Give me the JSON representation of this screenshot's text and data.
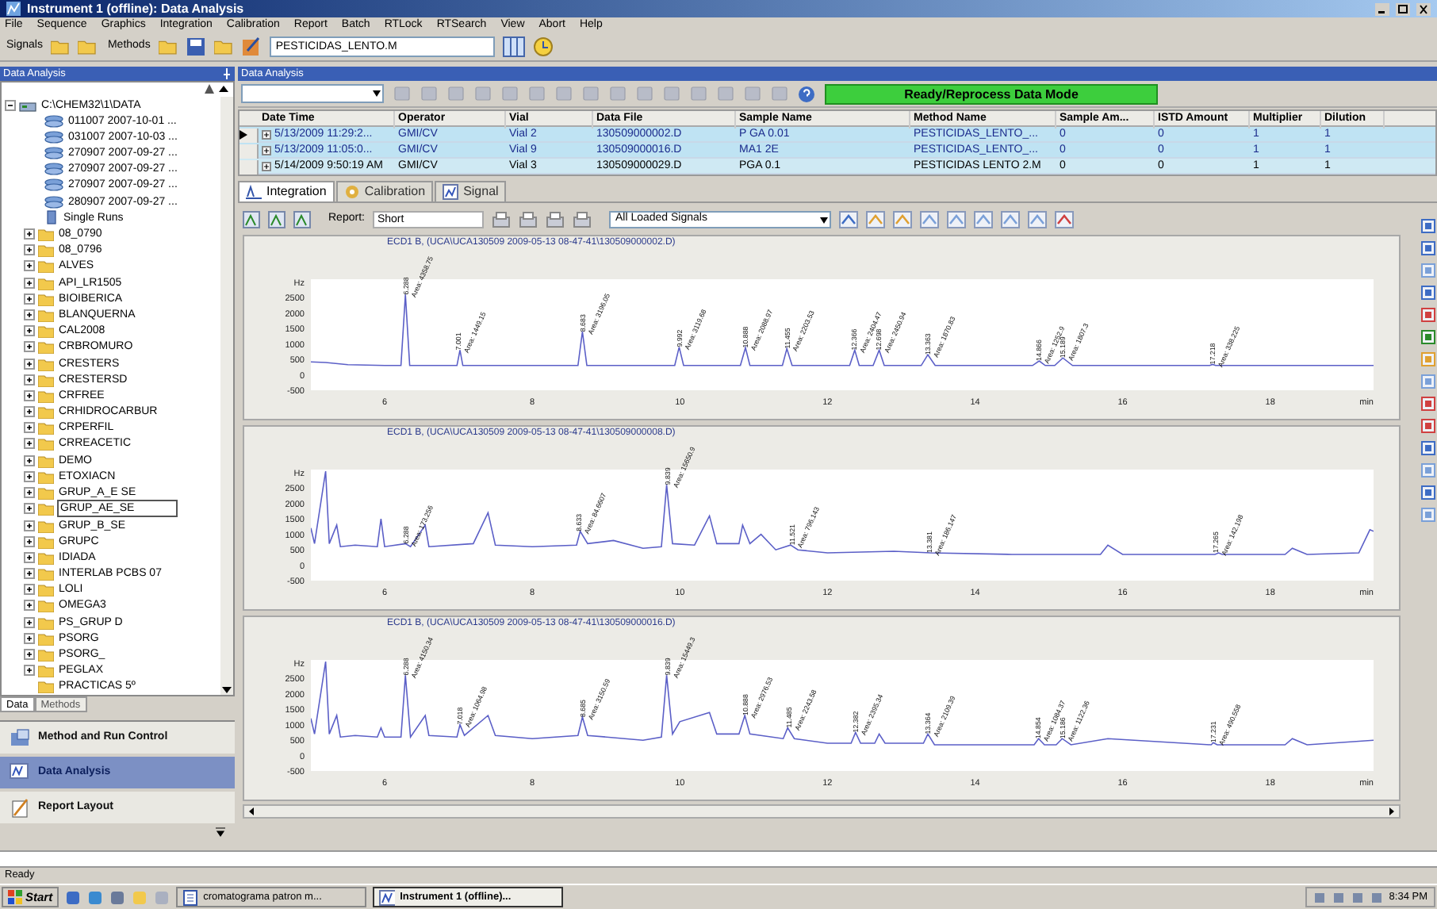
{
  "window": {
    "title": "Instrument 1 (offline): Data Analysis"
  },
  "menu": [
    "File",
    "Sequence",
    "Graphics",
    "Integration",
    "Calibration",
    "Report",
    "Batch",
    "RTLock",
    "RTSearch",
    "View",
    "Abort",
    "Help"
  ],
  "toolbar": {
    "signals_label": "Signals",
    "methods_label": "Methods",
    "method_field": "PESTICIDAS_LENTO.M"
  },
  "left_panel": {
    "title": "Data Analysis",
    "tree": [
      {
        "label": "C:\\CHEM32\\1\\DATA",
        "kind": "root",
        "expanded": true,
        "selected": false,
        "children": [
          {
            "label": "011007 2007-10-01 ...",
            "kind": "sequence",
            "selected": false
          },
          {
            "label": "031007 2007-10-03 ...",
            "kind": "sequence",
            "selected": false
          },
          {
            "label": "270907 2007-09-27 ...",
            "kind": "sequence",
            "selected": false
          },
          {
            "label": "270907 2007-09-27 ...",
            "kind": "sequence",
            "selected": false
          },
          {
            "label": "270907 2007-09-27 ...",
            "kind": "sequence",
            "selected": false
          },
          {
            "label": "280907 2007-09-27 ...",
            "kind": "sequence",
            "selected": false
          },
          {
            "label": "Single Runs",
            "kind": "single",
            "selected": false
          },
          {
            "label": "08_0790",
            "kind": "folder",
            "expanded": false,
            "selected": false
          },
          {
            "label": "08_0796",
            "kind": "folder",
            "expanded": false,
            "selected": false
          },
          {
            "label": "ALVES",
            "kind": "folder",
            "expanded": false,
            "selected": false
          },
          {
            "label": "API_LR1505",
            "kind": "folder",
            "expanded": false,
            "selected": false
          },
          {
            "label": "BIOIBERICA",
            "kind": "folder",
            "expanded": false,
            "selected": false
          },
          {
            "label": "BLANQUERNA",
            "kind": "folder",
            "expanded": false,
            "selected": false
          },
          {
            "label": "CAL2008",
            "kind": "folder",
            "expanded": false,
            "selected": false
          },
          {
            "label": "CRBROMURO",
            "kind": "folder",
            "expanded": false,
            "selected": false
          },
          {
            "label": "CRESTERS",
            "kind": "folder",
            "expanded": false,
            "selected": false
          },
          {
            "label": "CRESTERSD",
            "kind": "folder",
            "expanded": false,
            "selected": false
          },
          {
            "label": "CRFREE",
            "kind": "folder",
            "expanded": false,
            "selected": false
          },
          {
            "label": "CRHIDROCARBUR",
            "kind": "folder",
            "expanded": false,
            "selected": false
          },
          {
            "label": "CRPERFIL",
            "kind": "folder",
            "expanded": false,
            "selected": false
          },
          {
            "label": "CRREACETIC",
            "kind": "folder",
            "expanded": false,
            "selected": false
          },
          {
            "label": "DEMO",
            "kind": "folder",
            "expanded": false,
            "selected": false
          },
          {
            "label": "ETOXIACN",
            "kind": "folder",
            "expanded": false,
            "selected": false
          },
          {
            "label": "GRUP_A_E SE",
            "kind": "folder",
            "expanded": false,
            "selected": false
          },
          {
            "label": "GRUP_AE_SE",
            "kind": "folder",
            "expanded": false,
            "selected": true
          },
          {
            "label": "GRUP_B_SE",
            "kind": "folder",
            "expanded": false,
            "selected": false
          },
          {
            "label": "GRUPC",
            "kind": "folder",
            "expanded": false,
            "selected": false
          },
          {
            "label": "IDIADA",
            "kind": "folder",
            "expanded": false,
            "selected": false
          },
          {
            "label": "INTERLAB PCBS 07",
            "kind": "folder",
            "expanded": false,
            "selected": false
          },
          {
            "label": "LOLI",
            "kind": "folder",
            "expanded": false,
            "selected": false
          },
          {
            "label": "OMEGA3",
            "kind": "folder",
            "expanded": false,
            "selected": false
          },
          {
            "label": "PS_GRUP D",
            "kind": "folder",
            "expanded": false,
            "selected": false
          },
          {
            "label": "PSORG",
            "kind": "folder",
            "expanded": false,
            "selected": false
          },
          {
            "label": "PSORG_",
            "kind": "folder",
            "expanded": false,
            "selected": false
          },
          {
            "label": "PEGLAX",
            "kind": "folder",
            "expanded": false,
            "selected": false
          },
          {
            "label": "PRACTICAS 5º",
            "kind": "folder",
            "selected": false
          }
        ]
      }
    ],
    "tabs": [
      {
        "label": "Data",
        "selected": true
      },
      {
        "label": "Methods",
        "selected": false
      }
    ],
    "nav": [
      {
        "label": "Method and Run Control",
        "selected": false
      },
      {
        "label": "Data Analysis",
        "selected": true
      },
      {
        "label": "Report Layout",
        "selected": false
      }
    ]
  },
  "main": {
    "title": "Data Analysis",
    "mode_status": "Ready/Reprocess Data Mode",
    "table": {
      "columns": [
        "Date Time",
        "Operator",
        "Vial",
        "Data File",
        "Sample Name",
        "Method Name",
        "Sample Am...",
        "ISTD Amount",
        "Multiplier",
        "Dilution"
      ],
      "rows": [
        {
          "current": true,
          "selected": true,
          "cells": [
            "5/13/2009 11:29:2...",
            "GMI/CV",
            "Vial 2",
            "130509000002.D",
            "P GA 0.01",
            "PESTICIDAS_LENTO_...",
            "0",
            "0",
            "1",
            "1"
          ]
        },
        {
          "current": false,
          "selected": true,
          "cells": [
            "5/13/2009 11:05:0...",
            "GMI/CV",
            "Vial 9",
            "130509000016.D",
            "MA1 2E",
            "PESTICIDAS_LENTO_...",
            "0",
            "0",
            "1",
            "1"
          ]
        },
        {
          "current": false,
          "selected": false,
          "cells": [
            "5/14/2009 9:50:19 AM",
            "GMI/CV",
            "Vial 3",
            "130509000029.D",
            "PGA 0.1",
            "PESTICIDAS LENTO 2.M",
            "0",
            "0",
            "1",
            "1"
          ]
        }
      ]
    },
    "view_tabs": [
      {
        "label": "Integration",
        "selected": true
      },
      {
        "label": "Calibration",
        "selected": false
      },
      {
        "label": "Signal",
        "selected": false
      }
    ],
    "report_label": "Report:",
    "report_field": "Short",
    "signal_select": "All Loaded Signals",
    "charts": [
      {
        "chart_data": {
          "type": "line",
          "title": "ECD1 B, (UCA\\UCA130509 2009-05-13 08-47-41\\130509000002.D)",
          "xlabel": "min",
          "ylabel": "Hz",
          "xlim": [
            5,
            19.4
          ],
          "ylim": [
            -500,
            3100
          ],
          "xticks": [
            6,
            8,
            10,
            12,
            14,
            16,
            18
          ],
          "yticks": [
            -500,
            0,
            500,
            1000,
            1500,
            2000,
            2500
          ],
          "x": [
            5,
            5.2,
            5.5,
            6,
            6.22,
            6.28,
            6.34,
            6.98,
            7.02,
            7.06,
            8.62,
            8.68,
            8.74,
            9.93,
            9.99,
            10.05,
            10.82,
            10.89,
            10.95,
            11.39,
            11.45,
            11.52,
            12.3,
            12.37,
            12.43,
            12.62,
            12.7,
            12.77,
            13.27,
            13.36,
            13.46,
            14.78,
            14.87,
            14.95,
            15.08,
            15.19,
            15.32,
            17.18,
            17.22,
            17.26,
            19.4
          ],
          "series": [
            {
              "color": "#5b5fc7",
              "values": [
                420,
                400,
                330,
                300,
                300,
                2600,
                300,
                300,
                800,
                300,
                300,
                1400,
                300,
                300,
                900,
                300,
                300,
                880,
                300,
                300,
                850,
                300,
                300,
                800,
                300,
                300,
                800,
                300,
                300,
                650,
                300,
                300,
                450,
                300,
                300,
                550,
                300,
                300,
                340,
                300,
                300
              ]
            }
          ],
          "annotations": [
            {
              "x": 6.288,
              "y": 2600,
              "text": "6.288"
            },
            {
              "x": 6.288,
              "y": 2600,
              "text": "Area: 4358.75"
            },
            {
              "x": 7.001,
              "y": 800,
              "text": "7.001"
            },
            {
              "x": 7.001,
              "y": 800,
              "text": "Area: 1449.15"
            },
            {
              "x": 8.683,
              "y": 1400,
              "text": "8.683"
            },
            {
              "x": 8.683,
              "y": 1400,
              "text": "Area: 3196.05"
            },
            {
              "x": 9.992,
              "y": 900,
              "text": "9.992"
            },
            {
              "x": 9.992,
              "y": 900,
              "text": "Area: 3119.68"
            },
            {
              "x": 10.888,
              "y": 880,
              "text": "10.888"
            },
            {
              "x": 10.888,
              "y": 880,
              "text": "Area: 2088.97"
            },
            {
              "x": 11.455,
              "y": 850,
              "text": "11.455"
            },
            {
              "x": 11.455,
              "y": 850,
              "text": "Area: 2203.53"
            },
            {
              "x": 12.366,
              "y": 800,
              "text": "12.366"
            },
            {
              "x": 12.366,
              "y": 800,
              "text": "Area: 2404.47"
            },
            {
              "x": 12.698,
              "y": 800,
              "text": "12.698"
            },
            {
              "x": 12.698,
              "y": 800,
              "text": "Area: 2450.94"
            },
            {
              "x": 13.363,
              "y": 650,
              "text": "13.363"
            },
            {
              "x": 13.363,
              "y": 650,
              "text": "Area: 1870.83"
            },
            {
              "x": 14.866,
              "y": 450,
              "text": "14.866"
            },
            {
              "x": 14.866,
              "y": 450,
              "text": "Area: 1252.9"
            },
            {
              "x": 15.189,
              "y": 550,
              "text": "15.189"
            },
            {
              "x": 15.189,
              "y": 550,
              "text": "Area: 1807.3"
            },
            {
              "x": 17.218,
              "y": 340,
              "text": "17.218"
            },
            {
              "x": 17.218,
              "y": 340,
              "text": "Area: 338.225"
            }
          ]
        }
      },
      {
        "chart_data": {
          "type": "line",
          "title": "ECD1 B, (UCA\\UCA130509 2009-05-13 08-47-41\\130509000008.D)",
          "xlabel": "min",
          "ylabel": "Hz",
          "xlim": [
            5,
            19.4
          ],
          "ylim": [
            -500,
            3100
          ],
          "xticks": [
            6,
            8,
            10,
            12,
            14,
            16,
            18
          ],
          "yticks": [
            -500,
            0,
            500,
            1000,
            1500,
            2000,
            2500
          ],
          "x": [
            5,
            5.05,
            5.2,
            5.25,
            5.35,
            5.4,
            5.6,
            5.9,
            5.95,
            6,
            6.28,
            6.35,
            6.55,
            6.6,
            7.2,
            7.4,
            7.5,
            8,
            8.6,
            8.65,
            8.75,
            9.1,
            9.5,
            9.75,
            9.82,
            9.9,
            10.2,
            10.4,
            10.5,
            10.8,
            10.85,
            10.95,
            11.1,
            11.3,
            11.5,
            11.6,
            12,
            12.9,
            13.4,
            14.5,
            15.7,
            15.8,
            16,
            17.25,
            17.3,
            17.35,
            18.2,
            18.3,
            18.5,
            19.2,
            19.35,
            19.4
          ],
          "series": [
            {
              "color": "#5b5fc7",
              "values": [
                1200,
                700,
                3050,
                700,
                1300,
                600,
                650,
                600,
                1500,
                600,
                700,
                600,
                1300,
                600,
                700,
                1700,
                650,
                600,
                650,
                1100,
                700,
                800,
                550,
                600,
                2600,
                700,
                650,
                1600,
                700,
                700,
                1300,
                700,
                1000,
                500,
                650,
                500,
                400,
                450,
                400,
                350,
                350,
                650,
                350,
                350,
                400,
                350,
                350,
                550,
                350,
                400,
                1150,
                1100
              ]
            }
          ],
          "annotations": [
            {
              "x": 6.288,
              "y": 700,
              "text": "6.288"
            },
            {
              "x": 6.288,
              "y": 700,
              "text": "Area: 173.256"
            },
            {
              "x": 8.633,
              "y": 1100,
              "text": "8.633"
            },
            {
              "x": 8.633,
              "y": 1100,
              "text": "Area: 84.6607"
            },
            {
              "x": 9.839,
              "y": 2600,
              "text": "9.839"
            },
            {
              "x": 9.839,
              "y": 2600,
              "text": "Area: 15650.9"
            },
            {
              "x": 11.521,
              "y": 650,
              "text": "11.521"
            },
            {
              "x": 11.521,
              "y": 650,
              "text": "Area: 796.143"
            },
            {
              "x": 13.381,
              "y": 400,
              "text": "13.381"
            },
            {
              "x": 13.381,
              "y": 400,
              "text": "Area: 186.147"
            },
            {
              "x": 17.265,
              "y": 400,
              "text": "17.265"
            },
            {
              "x": 17.265,
              "y": 400,
              "text": "Area: 142.198"
            }
          ]
        }
      },
      {
        "chart_data": {
          "type": "line",
          "title": "ECD1 B, (UCA\\UCA130509 2009-05-13 08-47-41\\130509000016.D)",
          "xlabel": "min",
          "ylabel": "Hz",
          "xlim": [
            5,
            19.4
          ],
          "ylim": [
            -500,
            3100
          ],
          "xticks": [
            6,
            8,
            10,
            12,
            14,
            16,
            18
          ],
          "yticks": [
            -500,
            0,
            500,
            1000,
            1500,
            2000,
            2500
          ],
          "x": [
            5,
            5.05,
            5.2,
            5.25,
            5.35,
            5.4,
            5.6,
            5.9,
            5.95,
            6,
            6.22,
            6.28,
            6.35,
            6.55,
            6.6,
            6.98,
            7.02,
            7.08,
            7.4,
            7.5,
            8,
            8.62,
            8.68,
            8.75,
            9.5,
            9.75,
            9.82,
            9.9,
            10,
            10.4,
            10.5,
            10.8,
            10.88,
            10.95,
            11.4,
            11.46,
            11.55,
            12,
            12.32,
            12.38,
            12.45,
            12.64,
            12.7,
            12.78,
            13.3,
            13.36,
            13.45,
            14.8,
            14.86,
            14.94,
            15.1,
            15.18,
            15.3,
            15.8,
            17.2,
            17.23,
            17.28,
            18.2,
            18.3,
            18.5,
            19.4
          ],
          "series": [
            {
              "color": "#5b5fc7",
              "values": [
                1200,
                700,
                3050,
                700,
                1300,
                600,
                650,
                600,
                900,
                600,
                600,
                2600,
                600,
                1300,
                650,
                600,
                1000,
                650,
                1300,
                650,
                550,
                650,
                1250,
                650,
                500,
                600,
                2600,
                700,
                1100,
                1400,
                700,
                700,
                1300,
                700,
                550,
                900,
                550,
                400,
                400,
                750,
                400,
                400,
                700,
                400,
                400,
                700,
                350,
                350,
                550,
                350,
                350,
                550,
                350,
                550,
                350,
                420,
                350,
                350,
                550,
                350,
                500
              ]
            }
          ],
          "annotations": [
            {
              "x": 6.288,
              "y": 2600,
              "text": "6.288"
            },
            {
              "x": 6.288,
              "y": 2600,
              "text": "Area: 4150.34"
            },
            {
              "x": 7.018,
              "y": 1000,
              "text": "7.018"
            },
            {
              "x": 7.018,
              "y": 1000,
              "text": "Area: 1064.98"
            },
            {
              "x": 8.685,
              "y": 1250,
              "text": "8.685"
            },
            {
              "x": 8.685,
              "y": 1250,
              "text": "Area: 3150.59"
            },
            {
              "x": 9.839,
              "y": 2600,
              "text": "9.839"
            },
            {
              "x": 9.839,
              "y": 2600,
              "text": "Area: 15449.3"
            },
            {
              "x": 10.888,
              "y": 1300,
              "text": "10.888"
            },
            {
              "x": 10.888,
              "y": 1300,
              "text": "Area: 2976.53"
            },
            {
              "x": 11.485,
              "y": 900,
              "text": "11.485"
            },
            {
              "x": 11.485,
              "y": 900,
              "text": "Area: 2243.58"
            },
            {
              "x": 12.382,
              "y": 750,
              "text": "12.382"
            },
            {
              "x": 12.382,
              "y": 750,
              "text": "Area: 2395.34"
            },
            {
              "x": 13.364,
              "y": 700,
              "text": "13.364"
            },
            {
              "x": 13.364,
              "y": 700,
              "text": "Area: 2109.39"
            },
            {
              "x": 14.854,
              "y": 550,
              "text": "14.854"
            },
            {
              "x": 14.854,
              "y": 550,
              "text": "Area: 1084.37"
            },
            {
              "x": 15.186,
              "y": 550,
              "text": "15.186"
            },
            {
              "x": 15.186,
              "y": 550,
              "text": "Area: 1122.36"
            },
            {
              "x": 17.231,
              "y": 420,
              "text": "17.231"
            },
            {
              "x": 17.231,
              "y": 420,
              "text": "Area: 490.558"
            }
          ]
        }
      }
    ]
  },
  "status_bar": "Ready",
  "taskbar": {
    "start": "Start",
    "tasks": [
      {
        "label": "cromatograma patron m...",
        "selected": false
      },
      {
        "label": "Instrument 1 (offline)...",
        "selected": true
      }
    ],
    "clock": "8:34 PM"
  }
}
